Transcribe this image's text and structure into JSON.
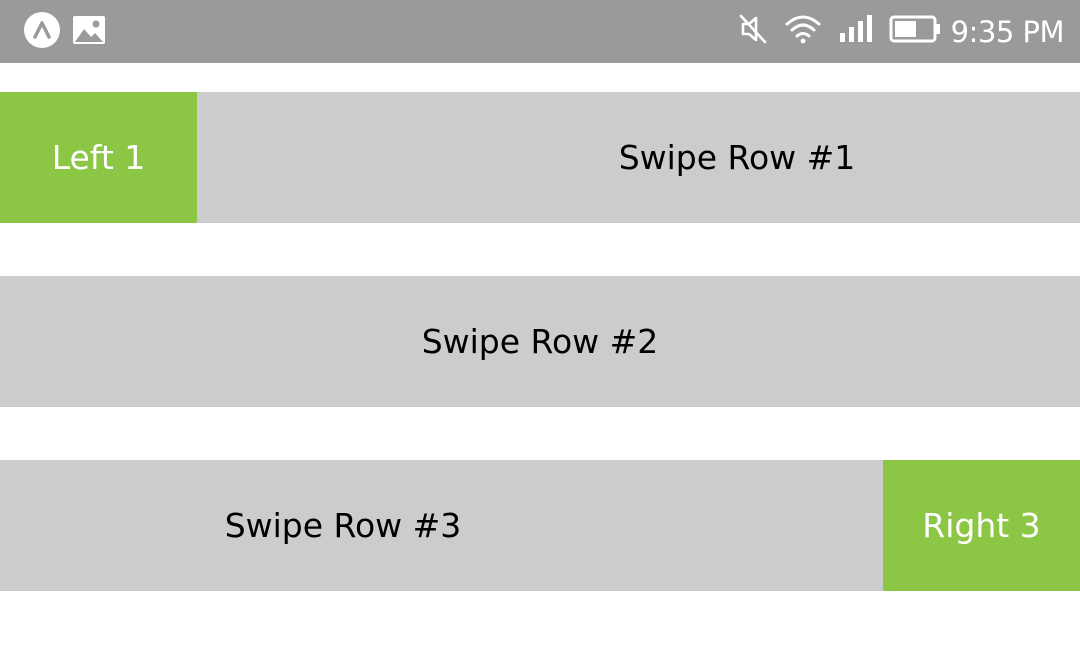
{
  "status_bar": {
    "time": "9:35 PM",
    "left_icons": [
      "expo-icon",
      "image-icon"
    ],
    "right_icons": [
      "mute-icon",
      "wifi-icon",
      "signal-icon",
      "battery-icon"
    ]
  },
  "colors": {
    "status_bar": "#9a9a9a",
    "row_front": "#cccccc",
    "action_back": "#8bc645",
    "row_text": "#000000",
    "action_text": "#ffffff"
  },
  "rows": [
    {
      "label": "Swipe Row #1",
      "action_label": "Left 1",
      "action_side": "left"
    },
    {
      "label": "Swipe Row #2",
      "action_label": "",
      "action_side": "none"
    },
    {
      "label": "Swipe Row #3",
      "action_label": "Right 3",
      "action_side": "right"
    }
  ]
}
